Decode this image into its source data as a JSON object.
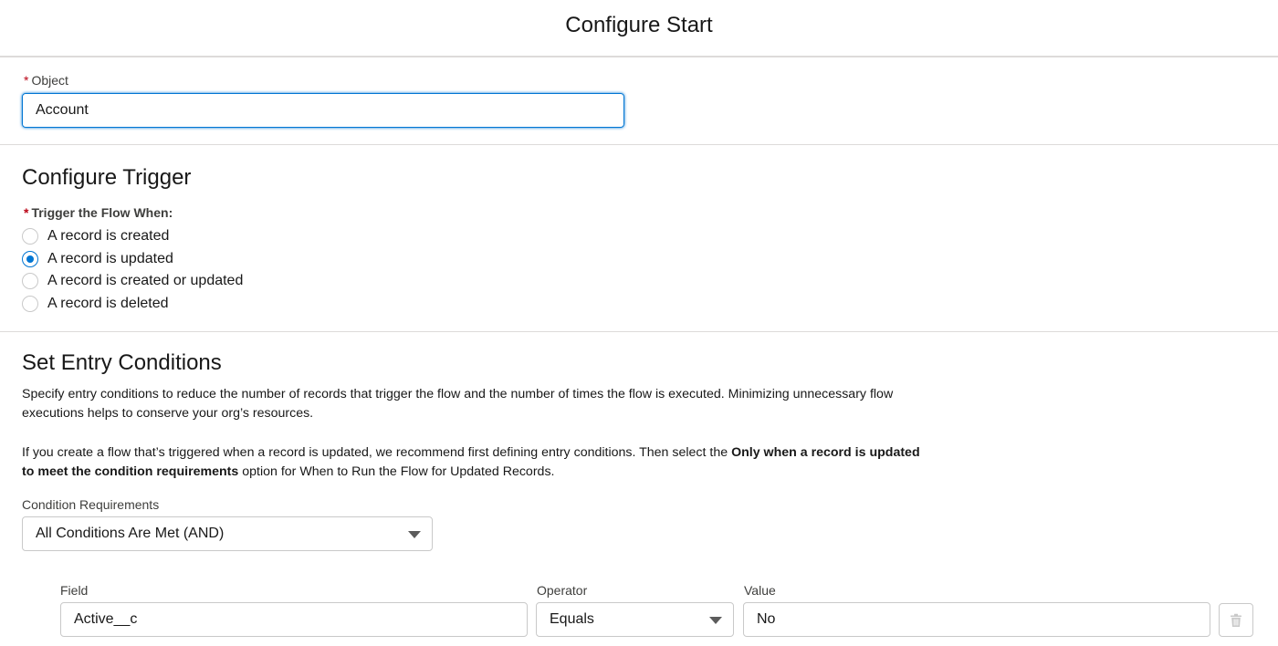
{
  "header": {
    "title": "Configure Start"
  },
  "object": {
    "required_mark": "*",
    "label": "Object",
    "value": "Account"
  },
  "trigger": {
    "title": "Configure Trigger",
    "required_mark": "*",
    "label": "Trigger the Flow When:",
    "options": [
      {
        "label": "A record is created",
        "checked": false
      },
      {
        "label": "A record is updated",
        "checked": true
      },
      {
        "label": "A record is created or updated",
        "checked": false
      },
      {
        "label": "A record is deleted",
        "checked": false
      }
    ]
  },
  "entry": {
    "title": "Set Entry Conditions",
    "desc1": "Specify entry conditions to reduce the number of records that trigger the flow and the number of times the flow is executed. Minimizing unnecessary flow executions helps to conserve your org’s resources.",
    "desc2_pre": "If you create a flow that’s triggered when a record is updated, we recommend first defining entry conditions. Then select the ",
    "desc2_bold": "Only when a record is updated to meet the condition requirements",
    "desc2_post": " option for When to Run the Flow for Updated Records.",
    "condition_label": "Condition Requirements",
    "condition_value": "All Conditions Are Met (AND)",
    "columns": {
      "field": "Field",
      "operator": "Operator",
      "value": "Value"
    },
    "row": {
      "field": "Active__c",
      "operator": "Equals",
      "value": "No"
    }
  },
  "colors": {
    "accent": "#0176d3",
    "required": "#ba0517",
    "border": "#c9c9c9"
  },
  "icons": {
    "delete": "trash-icon",
    "dropdown": "caret-down-icon"
  }
}
